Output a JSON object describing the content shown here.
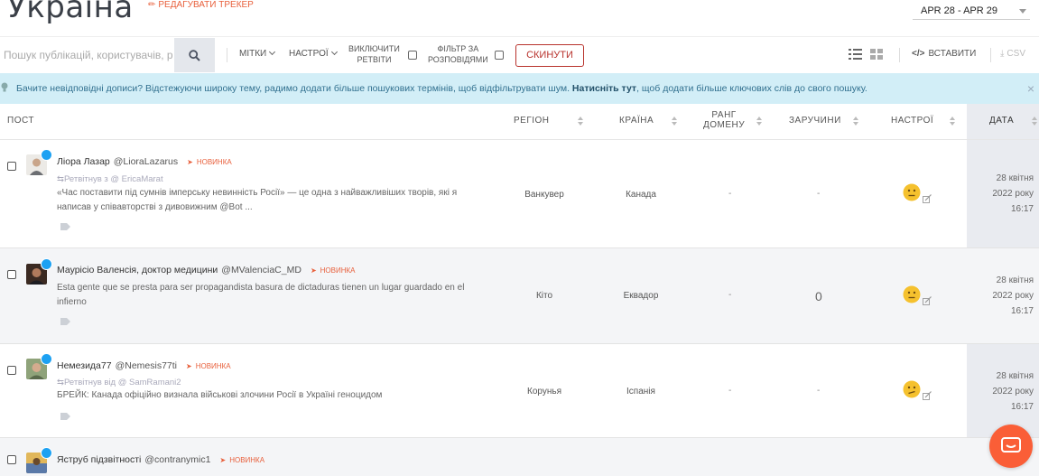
{
  "header": {
    "title": "Україна",
    "edit_label": "РЕДАГУВАТИ ТРЕКЕР",
    "date_range": "APR 28 - APR 29"
  },
  "toolbar": {
    "search_placeholder": "Пошук публікацій, користувачів, р",
    "tags_label": "МІТКИ",
    "sentiment_label": "НАСТРОЇ",
    "exclude_retweets_line1": "ВИКЛЮЧИТИ",
    "exclude_retweets_line2": "РЕТВІТИ",
    "filter_line1": "ФІЛЬТР ЗА",
    "filter_line2": "РОЗПОВІДЯМИ",
    "reset_label": "СКИНУТИ",
    "embed_label": "ВСТАВИТИ",
    "csv_label": "CSV"
  },
  "banner": {
    "text": "Бачите невідповідні дописи? Відстежуючи широку тему, радимо додати більше пошукових термінів, щоб відфільтрувати шум.",
    "link": "Натисніть тут",
    "text_after": ", щоб додати більше ключових слів до свого пошуку.",
    "close": "×"
  },
  "table": {
    "headers": {
      "post": "ПОСТ",
      "region": "РЕГІОН",
      "country": "КРАЇНА",
      "domain_rank_1": "РАНГ",
      "domain_rank_2": "ДОМЕНУ",
      "engagement": "ЗАРУЧИНИ",
      "sentiment": "НАСТРОЇ",
      "date": "ДАТА"
    },
    "rows": [
      {
        "name": "Ліора Лазар",
        "handle": "@LioraLazarus",
        "badge": "НОВИНКА",
        "retweet": "Ретвітнув з @ EricaMarat",
        "text": "«Час поставити під сумнів імперську невинність Росії» — це одна з найважливіших творів, які я написав у співавторстві з дивовижним @Bot ...",
        "region": "Ванкувер",
        "country": "Канада",
        "domain_rank": "-",
        "engagement": "-",
        "date_line1": "28 квітня",
        "date_line2": "2022 року",
        "date_line3": "16:17"
      },
      {
        "name": "Маурісіо Валенсія, доктор медицини",
        "handle": "@MValenciaC_MD",
        "badge": "НОВИНКА",
        "retweet": "",
        "text": "Esta gente que se presta para ser propagandista basura de dictaduras tienen un lugar guardado en el infierno",
        "region": "Кіто",
        "country": "Еквадор",
        "domain_rank": "-",
        "engagement": "0",
        "date_line1": "28 квітня",
        "date_line2": "2022 року",
        "date_line3": "16:17"
      },
      {
        "name": "Немезида77",
        "handle": "@Nemesis77ti",
        "badge": "НОВИНКА",
        "retweet": "Ретвітнув від @ SamRamani2",
        "text": "БРЕЙК: Канада офіційно визнала військові злочини Росії в Україні геноцидом",
        "region": "Корунья",
        "country": "Іспанія",
        "domain_rank": "-",
        "engagement": "-",
        "date_line1": "28 квітня",
        "date_line2": "2022 року",
        "date_line3": "16:17"
      },
      {
        "name": "Яструб підзвітності",
        "handle": "@contranymic1",
        "badge": "НОВИНКА"
      }
    ]
  },
  "colors": {
    "accent": "#e8603c",
    "reset": "#b8322c",
    "banner_bg": "#d2eef7",
    "twitter": "#1da1f2",
    "chat": "#fa5e37"
  }
}
